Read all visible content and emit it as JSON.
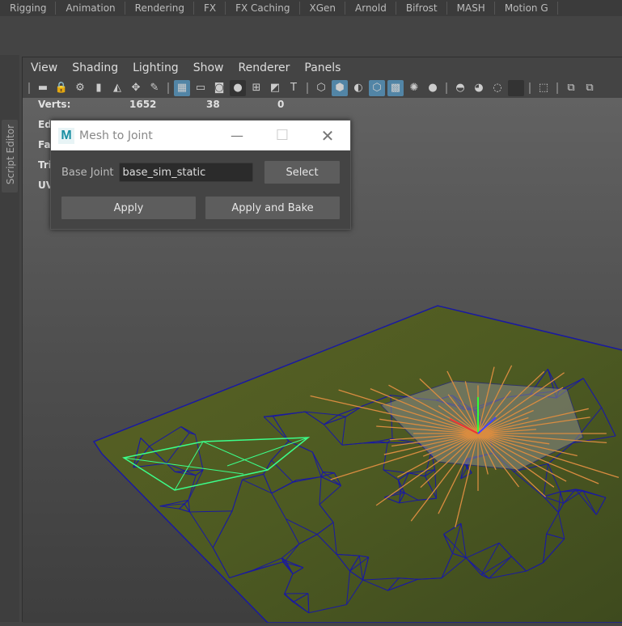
{
  "shelf_tabs": [
    "Rigging",
    "Animation",
    "Rendering",
    "FX",
    "FX Caching",
    "XGen",
    "Arnold",
    "Bifrost",
    "MASH",
    "Motion G"
  ],
  "side_tab": "Script Editor",
  "panel_menu": [
    "View",
    "Shading",
    "Lighting",
    "Show",
    "Renderer",
    "Panels"
  ],
  "hud": {
    "rows": [
      {
        "label": "Verts:",
        "v1": "1652",
        "v2": "38",
        "v3": "0"
      },
      {
        "label": "Edges:"
      },
      {
        "label": "Faces:"
      },
      {
        "label": "Tris:"
      },
      {
        "label": "UVs:"
      }
    ]
  },
  "dialog": {
    "title": "Mesh to Joint",
    "base_joint_label": "Base Joint",
    "base_joint_value": "base_sim_static",
    "select": "Select",
    "apply": "Apply",
    "apply_bake": "Apply and Bake",
    "logo": "M"
  },
  "colors": {
    "accent": "#5285a6",
    "wire": "#1a1aa0",
    "selection": "#3cff8a",
    "joint": "#d98c40"
  }
}
